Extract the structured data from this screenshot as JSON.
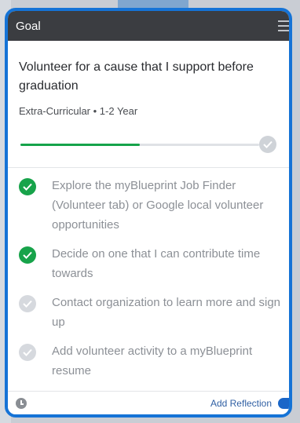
{
  "header": {
    "title": "Goal"
  },
  "goal": {
    "title": "Volunteer for a cause that I support before graduation",
    "meta": "Extra-Curricular • 1-2 Year",
    "progress": 0.5
  },
  "steps": [
    {
      "text": "Explore the myBlueprint Job Finder (Volunteer tab) or Google local volunteer opportunities",
      "done": true
    },
    {
      "text": "Decide on one that I can contribute time towards",
      "done": true
    },
    {
      "text": "Contact organization to learn more and sign up",
      "done": false
    },
    {
      "text": "Add volunteer activity to a myBlueprint resume",
      "done": false
    }
  ],
  "footer": {
    "add_reflection_label": "Add Reflection"
  },
  "colors": {
    "accent": "#1573d6",
    "complete": "#17a34a",
    "header": "#3b3d41"
  }
}
